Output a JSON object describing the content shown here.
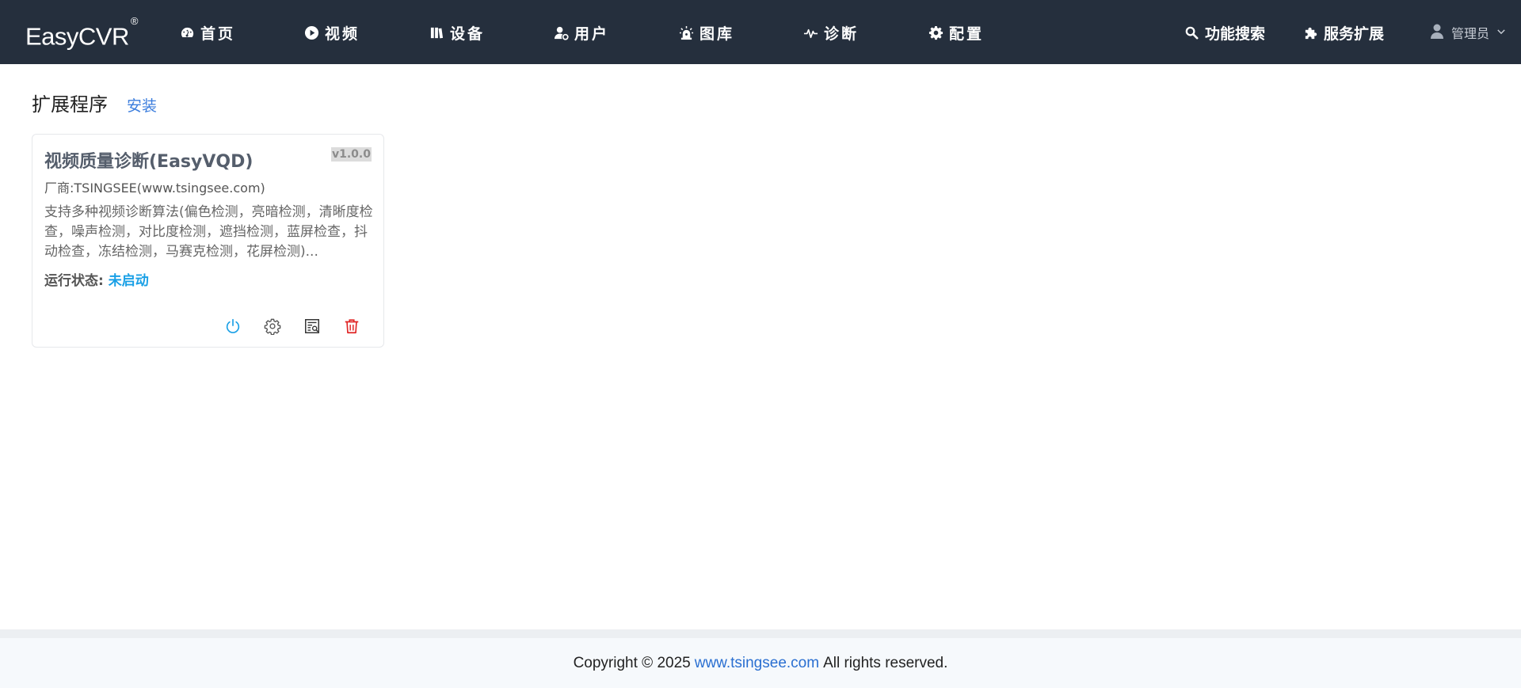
{
  "app": {
    "logo": "EasyCVR",
    "logo_mark": "®"
  },
  "nav": {
    "items": [
      {
        "label": "首页",
        "icon": "dashboard-icon"
      },
      {
        "label": "视频",
        "icon": "play-circle-icon"
      },
      {
        "label": "设备",
        "icon": "library-icon"
      },
      {
        "label": "用户",
        "icon": "user-gear-icon"
      },
      {
        "label": "图库",
        "icon": "alarm-light-icon"
      },
      {
        "label": "诊断",
        "icon": "pulse-icon"
      },
      {
        "label": "配置",
        "icon": "gear-icon"
      }
    ],
    "search_label": "功能搜索",
    "extension_label": "服务扩展",
    "user_label": "管理员"
  },
  "page": {
    "title": "扩展程序",
    "install_label": "安装"
  },
  "plugin": {
    "name": "视频质量诊断(EasyVQD)",
    "version": "v1.0.0",
    "vendor": "厂商:TSINGSEE(www.tsingsee.com)",
    "description": "支持多种视频诊断算法(偏色检测，亮暗检测，清晰度检查，噪声检测，对比度检测，遮挡检测，蓝屏检查，抖动检查，冻结检测，马赛克检测，花屏检测)...",
    "status_label": "运行状态:",
    "status_value": "未启动",
    "colors": {
      "status": "#1aa0e6",
      "delete": "#e02424",
      "power": "#1aa0e6"
    }
  },
  "footer": {
    "prefix": "Copyright © 2025",
    "link": "www.tsingsee.com",
    "suffix": "All rights reserved."
  }
}
